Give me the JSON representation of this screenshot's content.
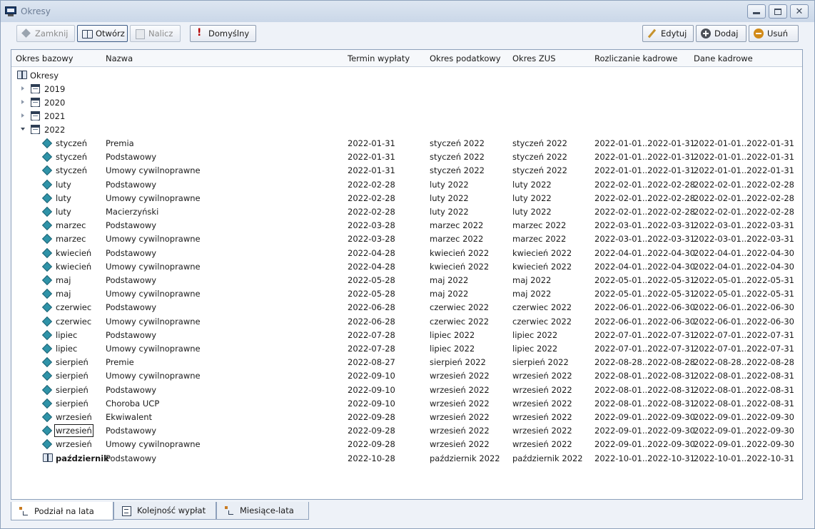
{
  "window": {
    "title": "Okresy"
  },
  "toolbar": {
    "close_label": "Zamknij",
    "open_label": "Otwórz",
    "calc_label": "Nalicz",
    "default_label": "Domyślny",
    "edit_label": "Edytuj",
    "add_label": "Dodaj",
    "delete_label": "Usuń"
  },
  "columns": [
    "Okres bazowy",
    "Nazwa",
    "Termin wypłaty",
    "Okres podatkowy",
    "Okres ZUS",
    "Rozliczanie kadrowe",
    "Dane kadrowe"
  ],
  "tree": {
    "root": "Okresy",
    "years": [
      "2019",
      "2020",
      "2021",
      "2022"
    ]
  },
  "rows": [
    [
      "styczeń",
      "Premia",
      "2022-01-31",
      "styczeń 2022",
      "styczeń 2022",
      "2022-01-01..2022-01-31",
      "2022-01-01..2022-01-31"
    ],
    [
      "styczeń",
      "Podstawowy",
      "2022-01-31",
      "styczeń 2022",
      "styczeń 2022",
      "2022-01-01..2022-01-31",
      "2022-01-01..2022-01-31"
    ],
    [
      "styczeń",
      "Umowy cywilnoprawne",
      "2022-01-31",
      "styczeń 2022",
      "styczeń 2022",
      "2022-01-01..2022-01-31",
      "2022-01-01..2022-01-31"
    ],
    [
      "luty",
      "Podstawowy",
      "2022-02-28",
      "luty 2022",
      "luty 2022",
      "2022-02-01..2022-02-28",
      "2022-02-01..2022-02-28"
    ],
    [
      "luty",
      "Umowy cywilnoprawne",
      "2022-02-28",
      "luty 2022",
      "luty 2022",
      "2022-02-01..2022-02-28",
      "2022-02-01..2022-02-28"
    ],
    [
      "luty",
      "Macierzyński",
      "2022-02-28",
      "luty 2022",
      "luty 2022",
      "2022-02-01..2022-02-28",
      "2022-02-01..2022-02-28"
    ],
    [
      "marzec",
      "Podstawowy",
      "2022-03-28",
      "marzec 2022",
      "marzec 2022",
      "2022-03-01..2022-03-31",
      "2022-03-01..2022-03-31"
    ],
    [
      "marzec",
      "Umowy cywilnoprawne",
      "2022-03-28",
      "marzec 2022",
      "marzec 2022",
      "2022-03-01..2022-03-31",
      "2022-03-01..2022-03-31"
    ],
    [
      "kwiecień",
      "Podstawowy",
      "2022-04-28",
      "kwiecień 2022",
      "kwiecień 2022",
      "2022-04-01..2022-04-30",
      "2022-04-01..2022-04-30"
    ],
    [
      "kwiecień",
      "Umowy cywilnoprawne",
      "2022-04-28",
      "kwiecień 2022",
      "kwiecień 2022",
      "2022-04-01..2022-04-30",
      "2022-04-01..2022-04-30"
    ],
    [
      "maj",
      "Podstawowy",
      "2022-05-28",
      "maj 2022",
      "maj 2022",
      "2022-05-01..2022-05-31",
      "2022-05-01..2022-05-31"
    ],
    [
      "maj",
      "Umowy cywilnoprawne",
      "2022-05-28",
      "maj 2022",
      "maj 2022",
      "2022-05-01..2022-05-31",
      "2022-05-01..2022-05-31"
    ],
    [
      "czerwiec",
      "Podstawowy",
      "2022-06-28",
      "czerwiec 2022",
      "czerwiec 2022",
      "2022-06-01..2022-06-30",
      "2022-06-01..2022-06-30"
    ],
    [
      "czerwiec",
      "Umowy cywilnoprawne",
      "2022-06-28",
      "czerwiec 2022",
      "czerwiec 2022",
      "2022-06-01..2022-06-30",
      "2022-06-01..2022-06-30"
    ],
    [
      "lipiec",
      "Podstawowy",
      "2022-07-28",
      "lipiec 2022",
      "lipiec 2022",
      "2022-07-01..2022-07-31",
      "2022-07-01..2022-07-31"
    ],
    [
      "lipiec",
      "Umowy cywilnoprawne",
      "2022-07-28",
      "lipiec 2022",
      "lipiec 2022",
      "2022-07-01..2022-07-31",
      "2022-07-01..2022-07-31"
    ],
    [
      "sierpień",
      "Premie",
      "2022-08-27",
      "sierpień 2022",
      "sierpień 2022",
      "2022-08-28..2022-08-28",
      "2022-08-28..2022-08-28"
    ],
    [
      "sierpień",
      "Umowy cywilnoprawne",
      "2022-09-10",
      "wrzesień 2022",
      "wrzesień 2022",
      "2022-08-01..2022-08-31",
      "2022-08-01..2022-08-31"
    ],
    [
      "sierpień",
      "Podstawowy",
      "2022-09-10",
      "wrzesień 2022",
      "wrzesień 2022",
      "2022-08-01..2022-08-31",
      "2022-08-01..2022-08-31"
    ],
    [
      "sierpień",
      "Choroba UCP",
      "2022-09-10",
      "wrzesień 2022",
      "wrzesień 2022",
      "2022-08-01..2022-08-31",
      "2022-08-01..2022-08-31"
    ],
    [
      "wrzesień",
      "Ekwiwalent",
      "2022-09-28",
      "wrzesień 2022",
      "wrzesień 2022",
      "2022-09-01..2022-09-30",
      "2022-09-01..2022-09-30"
    ],
    [
      "wrzesień",
      "Podstawowy",
      "2022-09-28",
      "wrzesień 2022",
      "wrzesień 2022",
      "2022-09-01..2022-09-30",
      "2022-09-01..2022-09-30"
    ],
    [
      "wrzesień",
      "Umowy cywilnoprawne",
      "2022-09-28",
      "wrzesień 2022",
      "wrzesień 2022",
      "2022-09-01..2022-09-30",
      "2022-09-01..2022-09-30"
    ],
    [
      "październik",
      "Podstawowy",
      "2022-10-28",
      "październik 2022",
      "październik 2022",
      "2022-10-01..2022-10-31",
      "2022-10-01..2022-10-31"
    ]
  ],
  "focused_row": 21,
  "current_row": 23,
  "tabs": [
    "Podział na lata",
    "Kolejność wypłat",
    "Miesiące-lata"
  ],
  "active_tab": 0,
  "colors": {
    "titlebar": "#cad7e8",
    "accent_icon": "#2f93a8",
    "default_mark": "#b30000"
  }
}
